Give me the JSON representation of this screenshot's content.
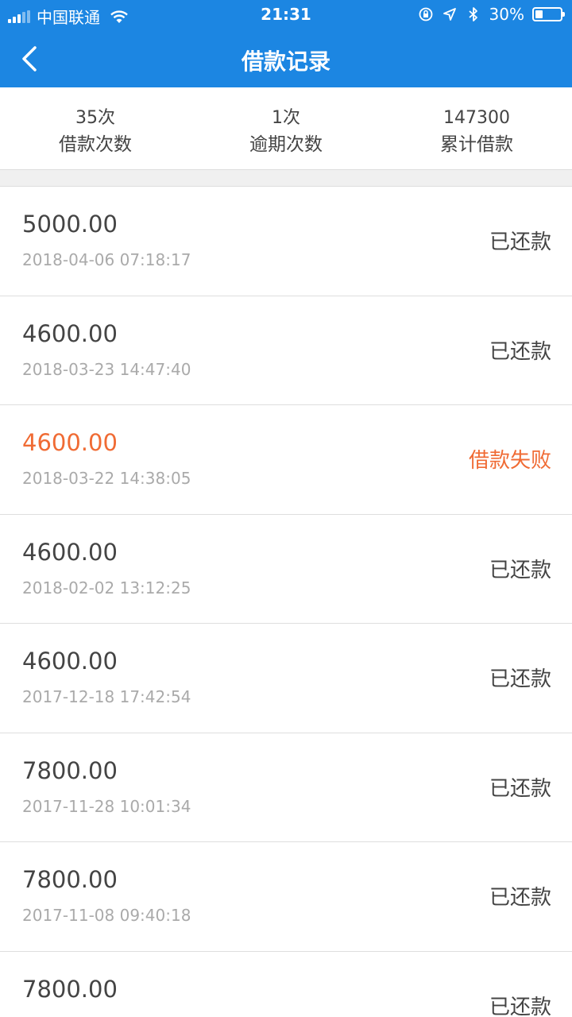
{
  "status_bar": {
    "carrier": "中国联通",
    "time": "21:31",
    "battery_pct": "30%",
    "battery_level": 0.3,
    "icons": [
      "signal-icon",
      "wifi-icon",
      "orientation-lock-icon",
      "location-icon",
      "bluetooth-icon",
      "battery-icon"
    ]
  },
  "header": {
    "title": "借款记录",
    "back_icon": "chevron-left-icon",
    "background": "#1c86e2"
  },
  "summary": [
    {
      "value": "35次",
      "label": "借款次数"
    },
    {
      "value": "1次",
      "label": "逾期次数"
    },
    {
      "value": "147300",
      "label": "累计借款"
    }
  ],
  "colors": {
    "accent": "#1c86e2",
    "failed": "#f06b34",
    "text": "#444444",
    "muted": "#aaaaaa"
  },
  "records": [
    {
      "amount": "5000.00",
      "date": "2018-04-06 07:18:17",
      "status": "已还款",
      "failed": false
    },
    {
      "amount": "4600.00",
      "date": "2018-03-23 14:47:40",
      "status": "已还款",
      "failed": false
    },
    {
      "amount": "4600.00",
      "date": "2018-03-22 14:38:05",
      "status": "借款失败",
      "failed": true
    },
    {
      "amount": "4600.00",
      "date": "2018-02-02 13:12:25",
      "status": "已还款",
      "failed": false
    },
    {
      "amount": "4600.00",
      "date": "2017-12-18 17:42:54",
      "status": "已还款",
      "failed": false
    },
    {
      "amount": "7800.00",
      "date": "2017-11-28 10:01:34",
      "status": "已还款",
      "failed": false
    },
    {
      "amount": "7800.00",
      "date": "2017-11-08 09:40:18",
      "status": "已还款",
      "failed": false
    },
    {
      "amount": "7800.00",
      "date": "",
      "status": "已还款",
      "failed": false
    }
  ]
}
